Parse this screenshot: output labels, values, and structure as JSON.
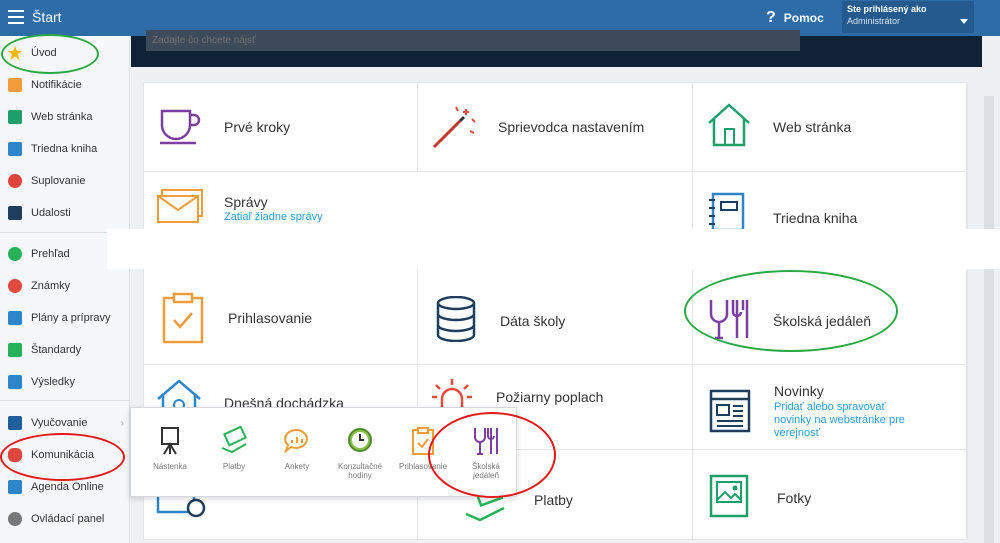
{
  "header": {
    "app_title": "Štart",
    "help_label": "Pomoc",
    "user_line1": "Ste prihlásený ako",
    "user_line2": "Administrátor"
  },
  "search": {
    "placeholder": "Zadajte čo chcete nájsť"
  },
  "sidebar": {
    "items": [
      {
        "label": "Úvod",
        "icon": "star-icon",
        "color": "#f5b800"
      },
      {
        "label": "Notifikácie",
        "icon": "mail-icon",
        "color": "#f39c3b"
      },
      {
        "label": "Web stránka",
        "icon": "house-icon",
        "color": "#1e9e6a"
      },
      {
        "label": "Triedna kniha",
        "icon": "book-icon",
        "color": "#2e86c9"
      },
      {
        "label": "Suplovanie",
        "icon": "person-icon",
        "color": "#e0463b"
      },
      {
        "label": "Udalosti",
        "icon": "calendar-icon",
        "color": "#1f3d5c"
      },
      {
        "label": "Prehľad",
        "icon": "check-icon",
        "color": "#27b25a"
      },
      {
        "label": "Známky",
        "icon": "grade-icon",
        "color": "#e04a3f"
      },
      {
        "label": "Plány a prípravy",
        "icon": "briefcase-icon",
        "color": "#2e86c9"
      },
      {
        "label": "Štandardy",
        "icon": "shield-icon",
        "color": "#27b25a"
      },
      {
        "label": "Výsledky",
        "icon": "bar-chart-icon",
        "color": "#2e86c9"
      },
      {
        "label": "Vyučovanie",
        "icon": "teaching-icon",
        "color": "#1f5f9c"
      },
      {
        "label": "Komunikácia",
        "icon": "chat-icon",
        "color": "#e0463b"
      },
      {
        "label": "Agenda Online",
        "icon": "pen-icon",
        "color": "#2e86c9"
      },
      {
        "label": "Ovládací panel",
        "icon": "gear-icon",
        "color": "#777777"
      }
    ]
  },
  "tiles": {
    "prve_kroky": "Prvé kroky",
    "sprievodca": "Sprievodca nastavením",
    "web_stranka": "Web stránka",
    "spravy": "Správy",
    "spravy_sub": "Zatiaľ žiadne správy",
    "triedna_kniha": "Triedna kniha",
    "prihlasovanie": "Prihlasovanie",
    "data_skoly": "Dáta školy",
    "skolska_jedalen": "Školská jedáleň",
    "dochadzka": "Dnešná dochádzka",
    "poziarny": "Požiarny poplach",
    "novinky": "Novinky",
    "novinky_sub": "Pridať alebo spravovať novinky na webstránke pre verejnosť",
    "platby": "Platby",
    "fotky": "Fotky"
  },
  "popup": {
    "items": [
      {
        "label": "Nástenka",
        "icon": "board-icon"
      },
      {
        "label": "Platby",
        "icon": "money-icon"
      },
      {
        "label": "Ankety",
        "icon": "poll-icon"
      },
      {
        "label": "Konzultačné hodiny",
        "icon": "clock-icon"
      },
      {
        "label": "Prihlasovanie",
        "icon": "clipboard-icon"
      },
      {
        "label": "Školská jedáleň",
        "icon": "cutlery-icon"
      }
    ]
  },
  "colors": {
    "topbar": "#2d6ca7",
    "accent_purple": "#7b3fa0",
    "accent_orange": "#f39c3b",
    "accent_green": "#1e9e6a",
    "accent_blue": "#2e86c9",
    "highlight_green": "#2aa845",
    "highlight_red": "#e01919"
  }
}
